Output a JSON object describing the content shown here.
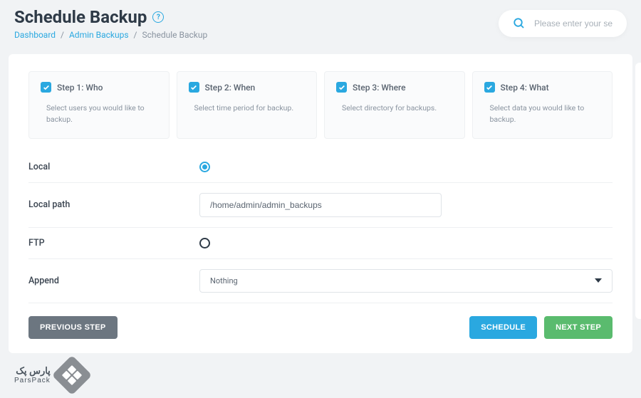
{
  "header": {
    "title": "Schedule Backup",
    "breadcrumb": {
      "dashboard": "Dashboard",
      "admin_backups": "Admin Backups",
      "current": "Schedule Backup"
    },
    "search_placeholder": "Please enter your search"
  },
  "steps": [
    {
      "title": "Step 1: Who",
      "desc": "Select users you would like to backup."
    },
    {
      "title": "Step 2: When",
      "desc": "Select time period for backup."
    },
    {
      "title": "Step 3: Where",
      "desc": "Select directory for backups."
    },
    {
      "title": "Step 4: What",
      "desc": "Select data you would like to backup."
    }
  ],
  "form": {
    "local_label": "Local",
    "local_path_label": "Local path",
    "local_path_value": "/home/admin/admin_backups",
    "ftp_label": "FTP",
    "append_label": "Append",
    "append_value": "Nothing"
  },
  "buttons": {
    "previous": "PREVIOUS STEP",
    "schedule": "SCHEDULE",
    "next": "NEXT STEP"
  },
  "brand": {
    "top": "پارس پک",
    "bottom": "ParsPack"
  }
}
